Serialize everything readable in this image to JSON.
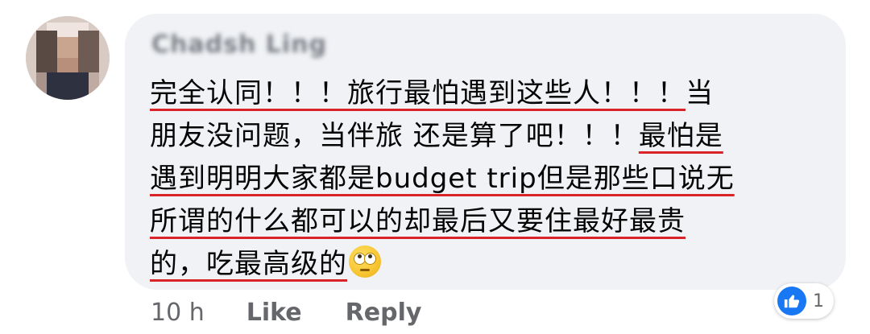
{
  "comment": {
    "author": "Chadsh Ling",
    "lines": [
      [
        {
          "text": "完全认同！！！旅行最怕遇到这些人！！！",
          "underline": true
        },
        {
          "text": "当",
          "underline": false
        }
      ],
      [
        {
          "text": "朋友没问题，当伴旅 还是算了吧！！！",
          "underline": false
        },
        {
          "text": "最怕是",
          "underline": true
        }
      ],
      [
        {
          "text": "遇到明明大家都是budget trip但是那些口说无",
          "underline": true
        }
      ],
      [
        {
          "text": "所谓的什么都可以的却最后又要住最好最贵",
          "underline": true
        }
      ],
      [
        {
          "text": "的，吃最高级的",
          "underline": true
        }
      ]
    ],
    "emoji": "face-with-rolling-eyes-emoji"
  },
  "actions": {
    "timestamp": "10 h",
    "like_label": "Like",
    "reply_label": "Reply"
  },
  "reactions": {
    "icon": "thumbs-up-icon",
    "count": "1"
  },
  "colors": {
    "bubble": "#f0f2f5",
    "underline": "#d9252a",
    "text": "#050505",
    "meta": "#65676b",
    "like_blue": "#1877f2"
  }
}
